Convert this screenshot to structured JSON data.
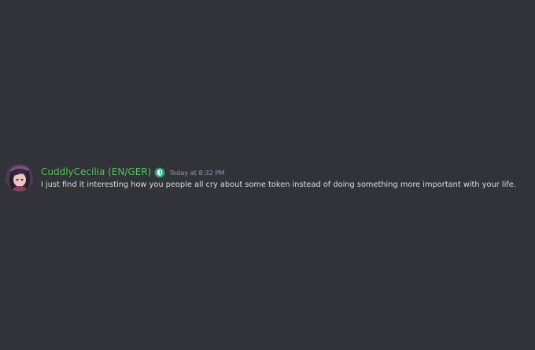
{
  "message": {
    "author": "CuddlyCecilia (EN/GER)",
    "author_color": "#57c25a",
    "badge_icon": "shield-icon",
    "timestamp": "Today at 8:32 PM",
    "content": "I just find it interesting how you people all cry about some token instead of doing something more important with your life."
  },
  "theme": {
    "background": "#313338",
    "text": "#dbdee1",
    "muted": "#949ba4"
  }
}
